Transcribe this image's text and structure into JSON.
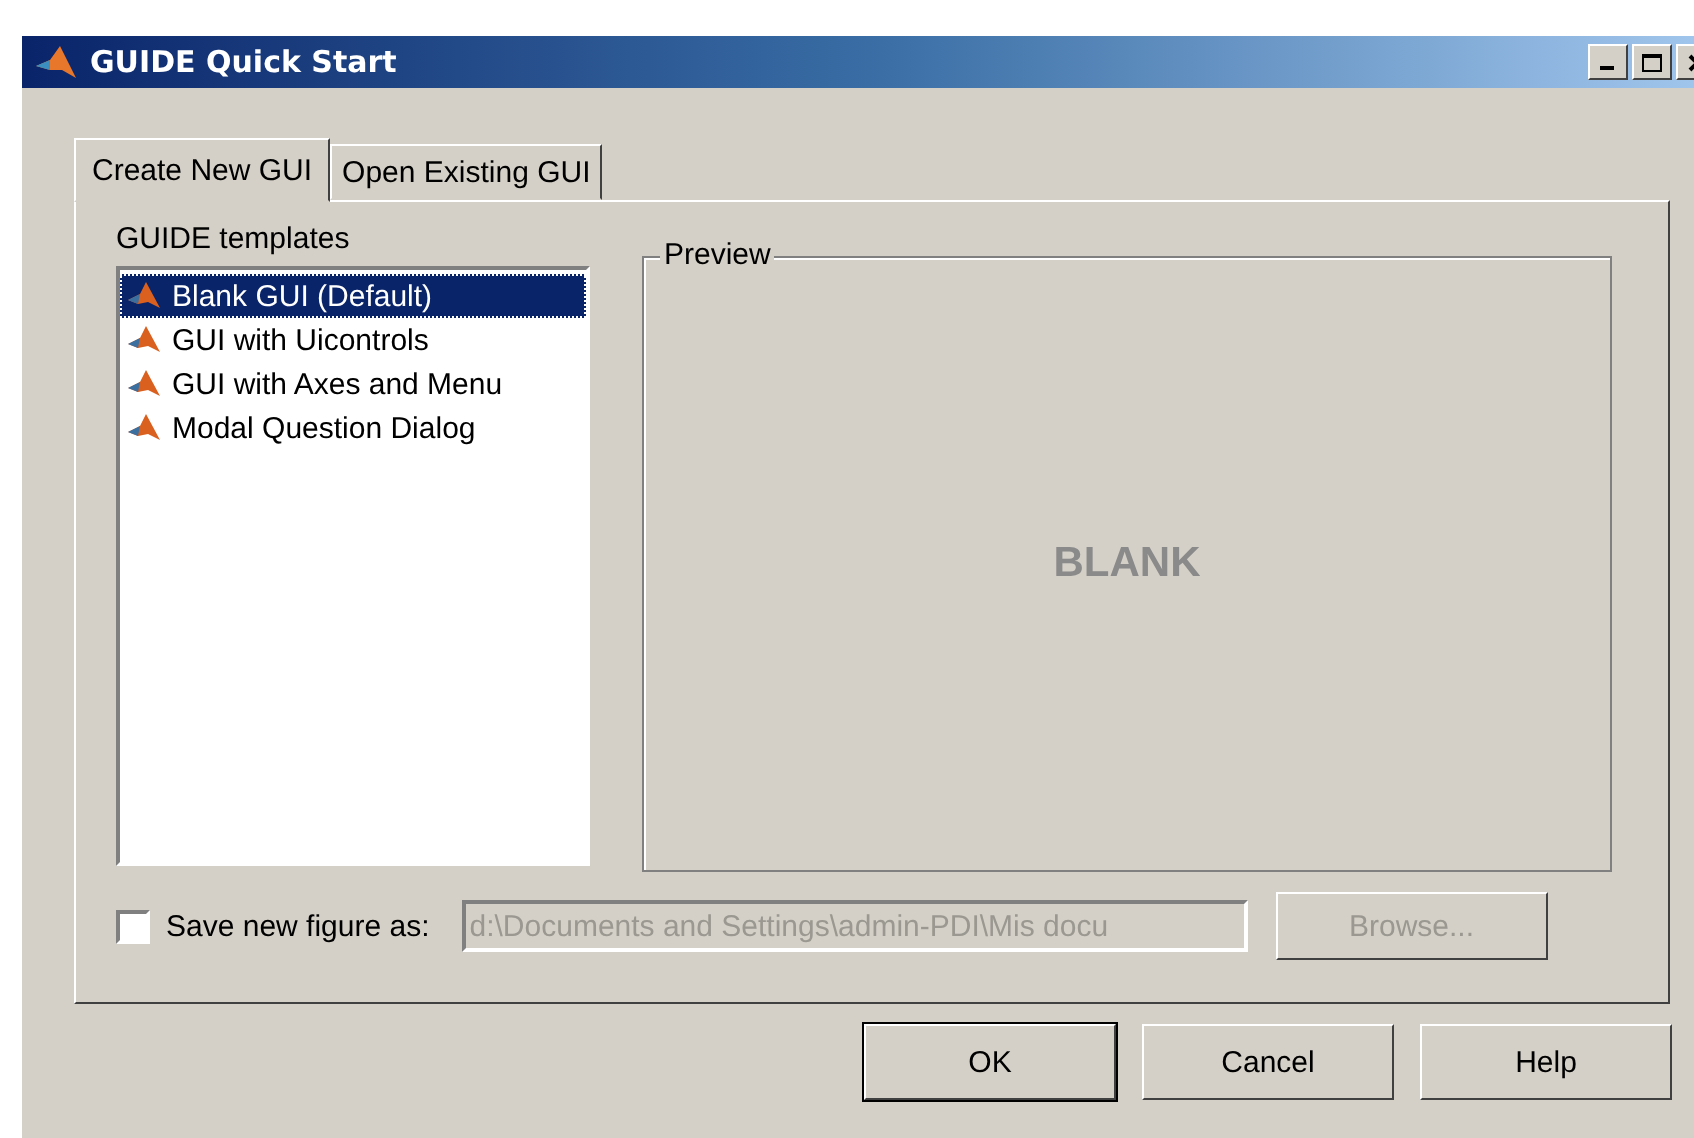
{
  "window": {
    "title": "GUIDE Quick Start"
  },
  "tabs": [
    {
      "label": "Create New GUI",
      "selected": true
    },
    {
      "label": "Open Existing GUI",
      "selected": false
    }
  ],
  "templates": {
    "label": "GUIDE templates",
    "items": [
      {
        "label": "Blank GUI (Default)",
        "selected": true
      },
      {
        "label": "GUI with Uicontrols",
        "selected": false
      },
      {
        "label": "GUI with Axes and Menu",
        "selected": false
      },
      {
        "label": "Modal Question Dialog",
        "selected": false
      }
    ]
  },
  "preview": {
    "label": "Preview",
    "text": "BLANK"
  },
  "save": {
    "label": "Save new figure as:",
    "checked": false,
    "value": "d:\\Documents and Settings\\admin-PDI\\Mis docu",
    "browse": "Browse...",
    "disabled": true
  },
  "buttons": [
    "OK",
    "Cancel",
    "Help"
  ]
}
